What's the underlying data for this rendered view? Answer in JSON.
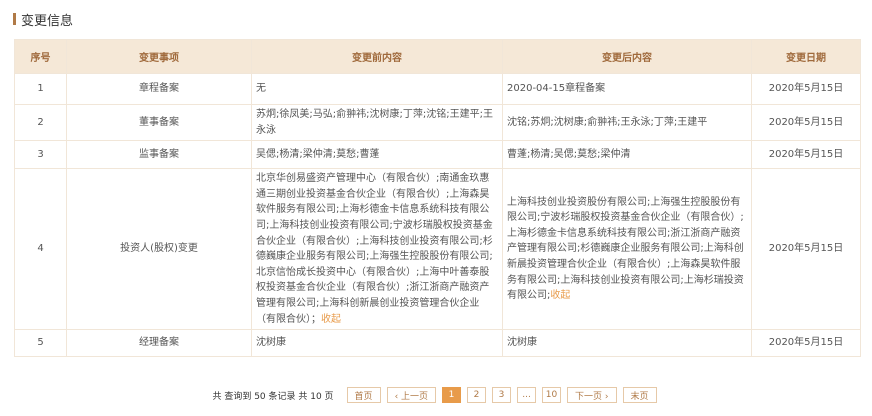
{
  "section": {
    "title": "变更信息"
  },
  "table": {
    "headers": [
      "序号",
      "变更事项",
      "变更前内容",
      "变更后内容",
      "变更日期"
    ],
    "collapse_label": "收起",
    "rows": [
      {
        "index": "1",
        "item": "章程备案",
        "before": "无",
        "after": "2020-04-15章程备案",
        "date": "2020年5月15日"
      },
      {
        "index": "2",
        "item": "董事备案",
        "before": "苏炯;徐凤美;马弘;俞翀祎;沈树康;丁萍;沈铭;王建平;王永泳",
        "after": "沈铭;苏炯;沈树康;俞翀祎;王永泳;丁萍;王建平",
        "date": "2020年5月15日"
      },
      {
        "index": "3",
        "item": "监事备案",
        "before": "吴偲;杨清;梁仲清;莫愁;曹蓬",
        "after": "曹蓬;杨清;吴偲;莫愁;梁仲清",
        "date": "2020年5月15日"
      },
      {
        "index": "4",
        "item": "投资人(股权)变更",
        "before": "北京华创易盛资产管理中心（有限合伙）;南通金玖惠通三期创业投资基金合伙企业（有限合伙）;上海森昊软件服务有限公司;上海杉德金卡信息系统科技有限公司;上海科技创业投资有限公司;宁波杉瑞股权投资基金合伙企业（有限合伙）;上海科技创业投资有限公司;杉德巍康企业服务有限公司;上海强生控股股份有限公司;北京信怡成长投资中心（有限合伙）;上海中叶善泰股权投资基金合伙企业（有限合伙）;浙江浙商产融资产管理有限公司;上海科创新晨创业投资管理合伙企业（有限合伙）；",
        "after": "上海科技创业投资股份有限公司;上海强生控股股份有限公司;宁波杉瑞股权投资基金合伙企业（有限合伙）;上海杉德金卡信息系统科技有限公司;浙江浙商产融资产管理有限公司;杉德巍康企业服务有限公司;上海科创新晨投资管理合伙企业（有限合伙）;上海森昊软件服务有限公司;上海科技创业投资有限公司;上海杉瑞投资有限公司;",
        "date": "2020年5月15日"
      },
      {
        "index": "5",
        "item": "经理备案",
        "before": "沈树康",
        "after": "沈树康",
        "date": "2020年5月15日"
      }
    ]
  },
  "pagination": {
    "summary": "共 查询到 50 条记录 共 10 页",
    "first": "首页",
    "prev": "‹ 上一页",
    "pages": [
      "1",
      "2",
      "3",
      "...",
      "10"
    ],
    "active": "1",
    "next": "下一页 ›",
    "last": "末页"
  },
  "colors": {
    "accent": "#b07a47",
    "header_bg": "#f5e8d7",
    "header_text": "#a06a3c",
    "link": "#e89b4a",
    "border": "#f1e6d8"
  }
}
